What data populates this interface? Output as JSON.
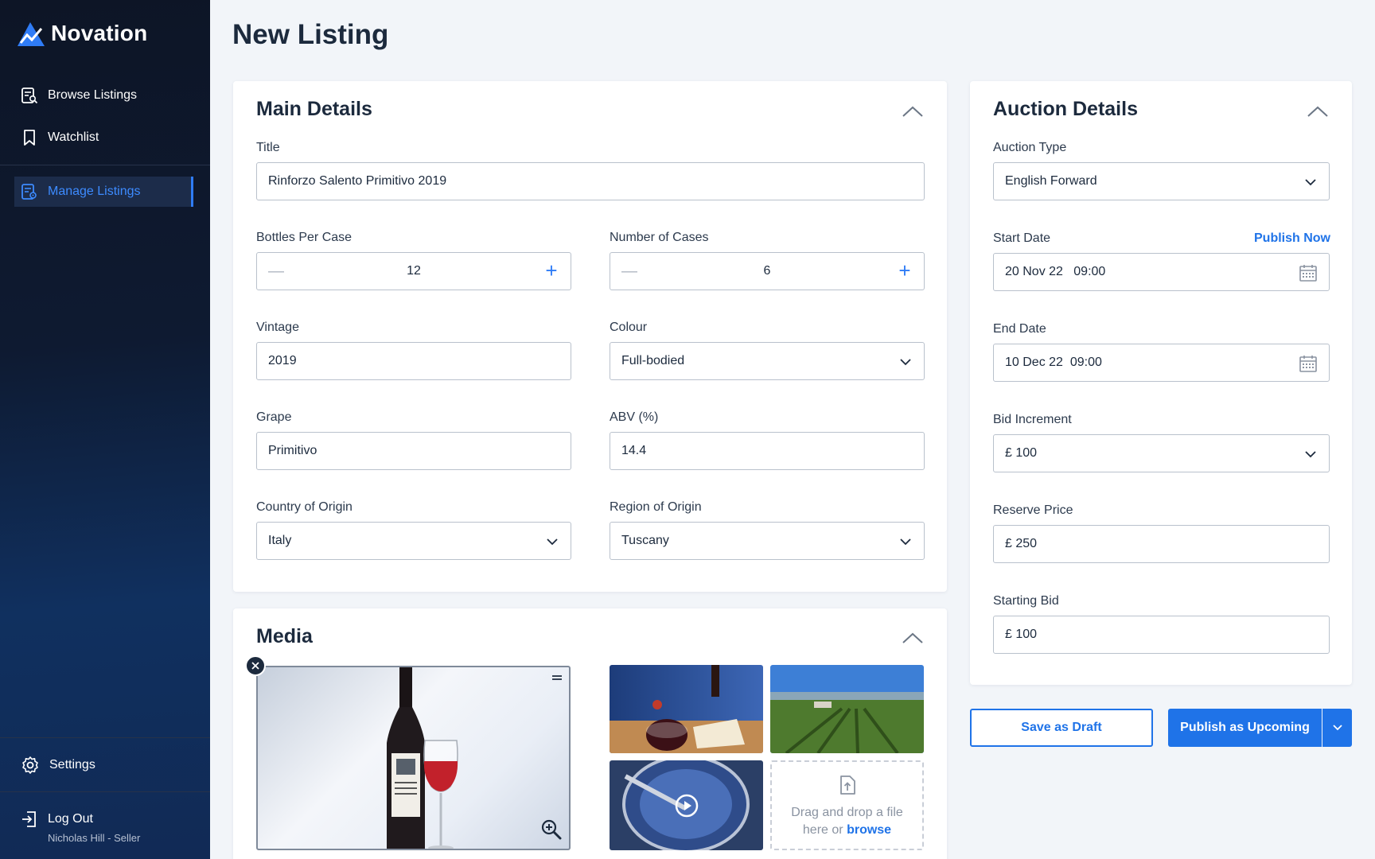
{
  "app": {
    "name": "Novation"
  },
  "sidebar": {
    "items": [
      {
        "label": "Browse Listings",
        "icon": "browse-listings-icon"
      },
      {
        "label": "Watchlist",
        "icon": "bookmark-icon"
      },
      {
        "label": "Manage Listings",
        "icon": "manage-listings-icon",
        "active": true
      }
    ],
    "settings_label": "Settings",
    "logout_label": "Log Out",
    "user": "Nicholas Hill - Seller"
  },
  "page": {
    "title": "New Listing"
  },
  "main_details": {
    "title": "Main Details",
    "title_field": {
      "label": "Title",
      "value": "Rinforzo Salento Primitivo 2019"
    },
    "bottles_per_case": {
      "label": "Bottles Per Case",
      "value": "12"
    },
    "number_of_cases": {
      "label": "Number of Cases",
      "value": "6"
    },
    "vintage": {
      "label": "Vintage",
      "value": "2019"
    },
    "colour": {
      "label": "Colour",
      "value": "Full-bodied"
    },
    "grape": {
      "label": "Grape",
      "value": "Primitivo"
    },
    "abv": {
      "label": "ABV (%)",
      "value": "14.4"
    },
    "country": {
      "label": "Country of Origin",
      "value": "Italy"
    },
    "region": {
      "label": "Region of Origin",
      "value": "Tuscany"
    }
  },
  "media": {
    "title": "Media",
    "dropzone_text": "Drag and drop a file here or",
    "browse_label": "browse"
  },
  "auction_details": {
    "title": "Auction Details",
    "auction_type": {
      "label": "Auction Type",
      "value": "English Forward"
    },
    "start_date": {
      "label": "Start Date",
      "value": "20 Nov 22   09:00",
      "action": "Publish Now"
    },
    "end_date": {
      "label": "End Date",
      "value": "10 Dec 22  09:00"
    },
    "bid_increment": {
      "label": "Bid Increment",
      "value": "£ 100"
    },
    "reserve_price": {
      "label": "Reserve Price",
      "value": "£ 250"
    },
    "starting_bid": {
      "label": "Starting Bid",
      "value": "£ 100"
    }
  },
  "actions": {
    "save_draft": "Save as Draft",
    "publish": "Publish as Upcoming"
  },
  "colors": {
    "accent": "#1f73e8",
    "sidebar": "#0e1a31",
    "text": "#1c2a3d"
  }
}
